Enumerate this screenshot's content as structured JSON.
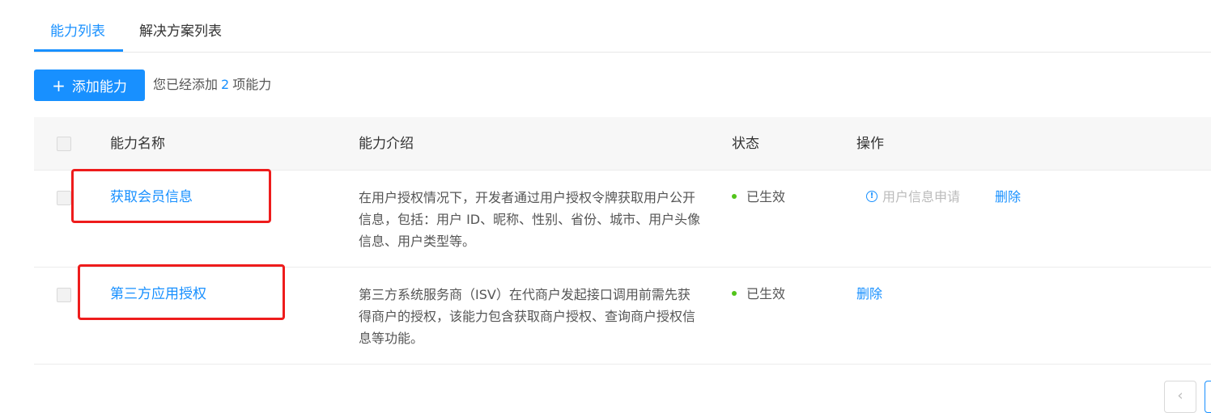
{
  "tabs": [
    {
      "label": "能力列表",
      "active": true
    },
    {
      "label": "解决方案列表",
      "active": false
    }
  ],
  "toolbar": {
    "add_label": "添加能力",
    "added_prefix": "您已经添加",
    "added_count": "2",
    "added_suffix": "项能力"
  },
  "table": {
    "headers": {
      "name": "能力名称",
      "intro": "能力介绍",
      "status": "状态",
      "action": "操作"
    },
    "rows": [
      {
        "name": "获取会员信息",
        "intro": "在用户授权情况下，开发者通过用户授权令牌获取用户公开信息，包括：用户 ID、昵称、性别、省份、城市、用户头像信息、用户类型等。",
        "status": "已生效",
        "apply_label": "用户信息申请",
        "delete_label": "删除"
      },
      {
        "name": "第三方应用授权",
        "intro": "第三方系统服务商（ISV）在代商户发起接口调用前需先获得商户的授权，该能力包含获取商户授权、查询商户授权信息等功能。",
        "status": "已生效",
        "delete_label": "删除"
      }
    ]
  },
  "pagination": {
    "prev_icon": "‹"
  },
  "colors": {
    "accent": "#1890ff",
    "status_active": "#52c41a",
    "highlight": "#ee1c1c"
  }
}
